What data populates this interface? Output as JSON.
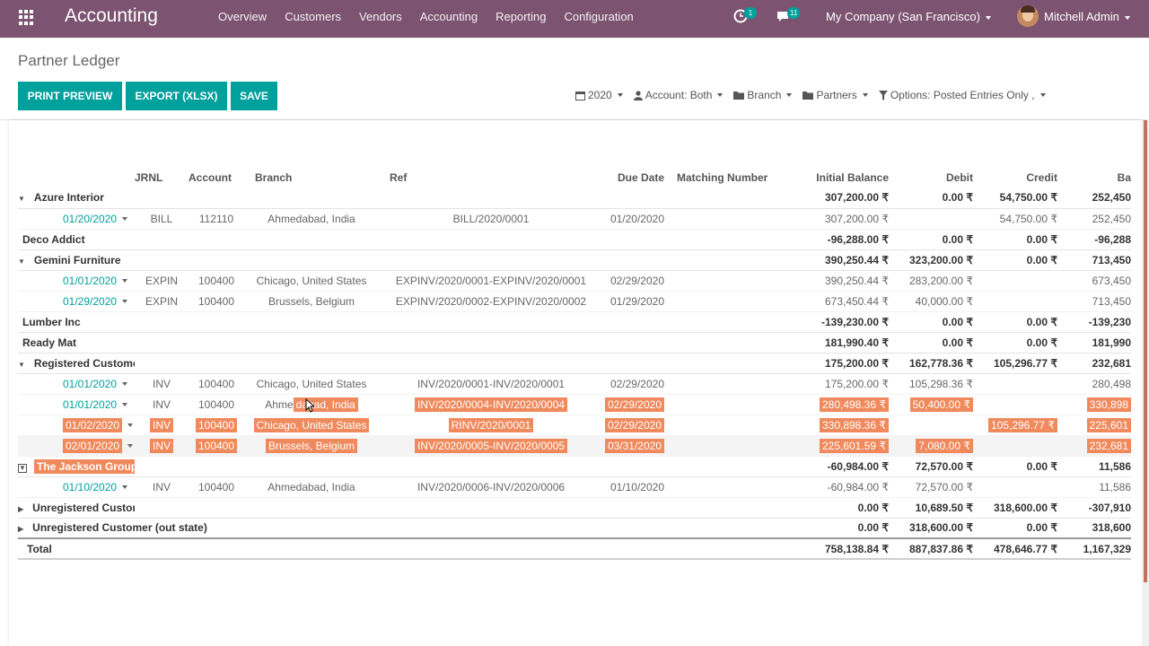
{
  "navbar": {
    "brand": "Accounting",
    "menu": [
      "Overview",
      "Customers",
      "Vendors",
      "Accounting",
      "Reporting",
      "Configuration"
    ],
    "activity_count": "1",
    "message_count": "11",
    "company": "My Company (San Francisco)",
    "user": "Mitchell Admin"
  },
  "control_panel": {
    "title": "Partner Ledger",
    "buttons": {
      "print": "PRINT PREVIEW",
      "export": "EXPORT (XLSX)",
      "save": "SAVE"
    },
    "filters": {
      "date": "2020",
      "account": "Account: Both",
      "branch": "Branch",
      "partners": "Partners",
      "options": "Options: Posted Entries Only ,"
    }
  },
  "table": {
    "headers": [
      "",
      "JRNL",
      "Account",
      "Branch",
      "Ref",
      "Due Date",
      "Matching Number",
      "Initial Balance",
      "Debit",
      "Credit",
      "Ba"
    ],
    "partners": [
      {
        "name": "Azure Interior",
        "toggle": "expanded",
        "initial": "307,200.00 ₹",
        "debit": "0.00 ₹",
        "credit": "54,750.00 ₹",
        "balance": "252,450",
        "lines": [
          {
            "date": "01/20/2020",
            "jrnl": "BILL",
            "account": "112110",
            "branch": "Ahmedabad, India",
            "ref": "BILL/2020/0001",
            "due": "01/20/2020",
            "initial": "307,200.00 ₹",
            "debit": "",
            "credit": "54,750.00 ₹",
            "balance": "252,450"
          }
        ]
      },
      {
        "name": "Deco Addict",
        "toggle": "none",
        "initial": "-96,288.00 ₹",
        "debit": "0.00 ₹",
        "credit": "0.00 ₹",
        "balance": "-96,288",
        "lines": []
      },
      {
        "name": "Gemini Furniture",
        "toggle": "expanded",
        "initial": "390,250.44 ₹",
        "debit": "323,200.00 ₹",
        "credit": "0.00 ₹",
        "balance": "713,450",
        "lines": [
          {
            "date": "01/01/2020",
            "jrnl": "EXPIN",
            "account": "100400",
            "branch": "Chicago, United States",
            "ref": "EXPINV/2020/0001-EXPINV/2020/0001",
            "due": "02/29/2020",
            "initial": "390,250.44 ₹",
            "debit": "283,200.00 ₹",
            "credit": "",
            "balance": "673,450"
          },
          {
            "date": "01/29/2020",
            "jrnl": "EXPIN",
            "account": "100400",
            "branch": "Brussels, Belgium",
            "ref": "EXPINV/2020/0002-EXPINV/2020/0002",
            "due": "01/29/2020",
            "initial": "673,450.44 ₹",
            "debit": "40,000.00 ₹",
            "credit": "",
            "balance": "713,450"
          }
        ]
      },
      {
        "name": "Lumber Inc",
        "toggle": "none",
        "initial": "-139,230.00 ₹",
        "debit": "0.00 ₹",
        "credit": "0.00 ₹",
        "balance": "-139,230",
        "lines": []
      },
      {
        "name": "Ready Mat",
        "toggle": "none",
        "initial": "181,990.40 ₹",
        "debit": "0.00 ₹",
        "credit": "0.00 ₹",
        "balance": "181,990",
        "lines": []
      },
      {
        "name": "Registered Customer",
        "toggle": "expanded",
        "initial": "175,200.00 ₹",
        "debit": "162,778.36 ₹",
        "credit": "105,296.77 ₹",
        "balance": "232,681",
        "lines": [
          {
            "date": "01/01/2020",
            "jrnl": "INV",
            "account": "100400",
            "branch": "Chicago, United States",
            "ref": "INV/2020/0001-INV/2020/0001",
            "due": "02/29/2020",
            "initial": "175,200.00 ₹",
            "debit": "105,298.36 ₹",
            "credit": "",
            "balance": "280,498"
          },
          {
            "date": "01/01/2020",
            "jrnl": "INV",
            "account": "100400",
            "branch_pre": "Ahme",
            "branch_hl": "dabad, India",
            "ref": "INV/2020/0004-INV/2020/0004",
            "due": "02/29/2020",
            "initial": "280,498.36 ₹",
            "debit": "50,400.00 ₹",
            "credit": "",
            "balance": "330,898"
          },
          {
            "date": "01/02/2020",
            "jrnl": "INV",
            "account": "100400",
            "branch": "Chicago, United States",
            "ref": "RINV/2020/0001",
            "due": "02/29/2020",
            "initial": "330,898.36 ₹",
            "debit": "",
            "credit": "105,296.77 ₹",
            "balance": "225,601"
          },
          {
            "date": "02/01/2020",
            "jrnl": "INV",
            "account": "100400",
            "branch": "Brussels, Belgium",
            "ref": "INV/2020/0005-INV/2020/0005",
            "due": "03/31/2020",
            "initial": "225,601.59 ₹",
            "debit": "7,080.00 ₹",
            "credit": "",
            "balance": "232,681"
          }
        ]
      },
      {
        "name": "The Jackson Group",
        "toggle": "box",
        "initial": "-60,984.00 ₹",
        "debit": "72,570.00 ₹",
        "credit": "0.00 ₹",
        "balance": "11,586",
        "lines": [
          {
            "date": "01/10/2020",
            "jrnl": "INV",
            "account": "100400",
            "branch": "Ahmedabad, India",
            "ref": "INV/2020/0006-INV/2020/0006",
            "due": "01/10/2020",
            "initial": "-60,984.00 ₹",
            "debit": "72,570.00 ₹",
            "credit": "",
            "balance": "11,586"
          }
        ]
      },
      {
        "name": "Unregistered Customer",
        "toggle": "collapsed",
        "initial": "0.00 ₹",
        "debit": "10,689.50 ₹",
        "credit": "318,600.00 ₹",
        "balance": "-307,910",
        "lines": []
      },
      {
        "name": "Unregistered Customer (out state)",
        "toggle": "collapsed",
        "initial": "0.00 ₹",
        "debit": "318,600.00 ₹",
        "credit": "0.00 ₹",
        "balance": "318,600",
        "lines": []
      }
    ],
    "total": {
      "label": "Total",
      "initial": "758,138.84 ₹",
      "debit": "887,837.86 ₹",
      "credit": "478,646.77 ₹",
      "balance": "1,167,329"
    }
  },
  "colors": {
    "navbar": "#7c5471",
    "primary": "#00a09d",
    "highlight": "#f08a5d"
  },
  "icons": {
    "apps": "apps-grid-icon",
    "activity": "clock-icon",
    "messages": "chat-icon",
    "calendar": "calendar-icon",
    "user": "user-icon",
    "folder": "folder-icon",
    "filter": "filter-icon"
  }
}
